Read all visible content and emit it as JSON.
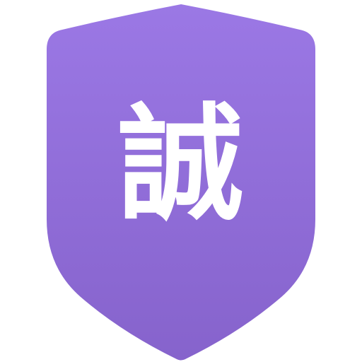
{
  "icon": {
    "name": "shield-icon",
    "glyph": "誠",
    "colors": {
      "gradient_top": "#9B78E5",
      "gradient_bottom": "#8663CC",
      "glyph": "#FFFFFF",
      "background": "#FFFFFF"
    }
  }
}
